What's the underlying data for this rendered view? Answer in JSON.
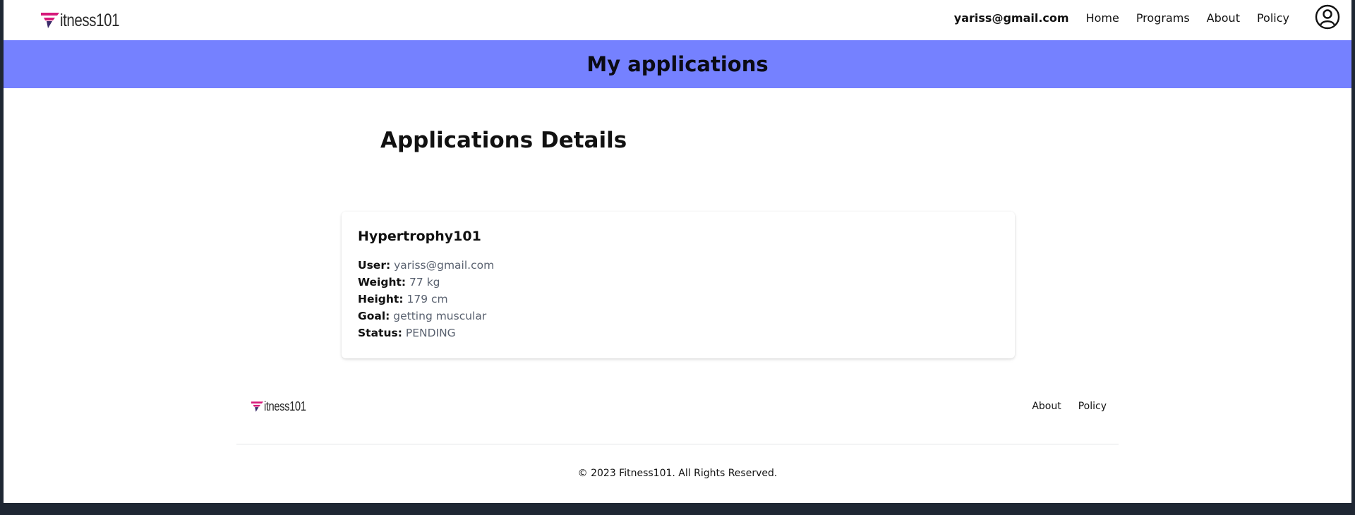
{
  "brand": {
    "name": "itness101",
    "accent": "#d6197a"
  },
  "nav": {
    "email": "yariss@gmail.com",
    "links": [
      "Home",
      "Programs",
      "About",
      "Policy"
    ],
    "account_icon": "user-circle-icon"
  },
  "banner": {
    "title": "My applications",
    "color": "#7581ff"
  },
  "section": {
    "title": "Applications Details"
  },
  "application": {
    "program": "Hypertrophy101",
    "fields": [
      {
        "label": "User:",
        "value": "yariss@gmail.com"
      },
      {
        "label": "Weight:",
        "value": "77 kg"
      },
      {
        "label": "Height:",
        "value": "179 cm"
      },
      {
        "label": "Goal:",
        "value": "getting muscular"
      },
      {
        "label": "Status:",
        "value": "PENDING"
      }
    ]
  },
  "footer": {
    "brand": "itness101",
    "links": [
      "About",
      "Policy"
    ],
    "copyright": "© 2023 Fitness101. All Rights Reserved."
  }
}
